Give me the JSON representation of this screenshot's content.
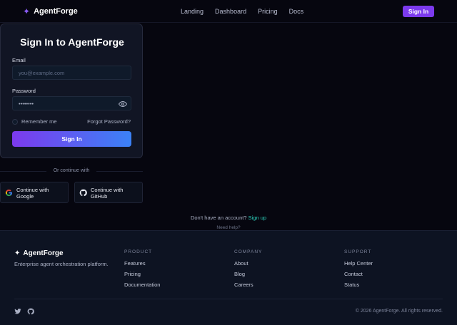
{
  "nav": {
    "brand": "AgentForge",
    "links": [
      "Landing",
      "Dashboard",
      "Pricing",
      "Docs"
    ],
    "signin_label": "Sign In"
  },
  "card": {
    "title": "Sign In to AgentForge",
    "email_label": "Email",
    "email_placeholder": "you@example.com",
    "password_label": "Password",
    "password_value": "••••••••",
    "remember_label": "Remember me",
    "forgot_label": "Forgot Password?",
    "submit_label": "Sign In"
  },
  "divider_text": "Or continue with",
  "social": {
    "google_label": "Continue with Google",
    "github_label": "Continue with GitHub"
  },
  "signup": {
    "prompt": "Don't have an account?",
    "link": "Sign up"
  },
  "help_text": "Need help?",
  "footer": {
    "brand": "AgentForge",
    "tagline": "Enterprise agent orchestration platform.",
    "columns": [
      {
        "heading": "PRODUCT",
        "items": [
          "Features",
          "Pricing",
          "Documentation"
        ]
      },
      {
        "heading": "COMPANY",
        "items": [
          "About",
          "Blog",
          "Careers"
        ]
      },
      {
        "heading": "SUPPORT",
        "items": [
          "Help Center",
          "Contact",
          "Status"
        ]
      }
    ],
    "copyright": "© 2026 AgentForge. All rights reserved."
  },
  "icons": {
    "brand": "sparkle-icon",
    "password_toggle": "eye-icon",
    "google": "google-icon",
    "github": "github-icon",
    "twitter": "twitter-icon"
  },
  "colors": {
    "accent": "#7c3aed",
    "accent_blue": "#3b82f6",
    "link_teal": "#2dd4bf",
    "background": "#06060f"
  }
}
